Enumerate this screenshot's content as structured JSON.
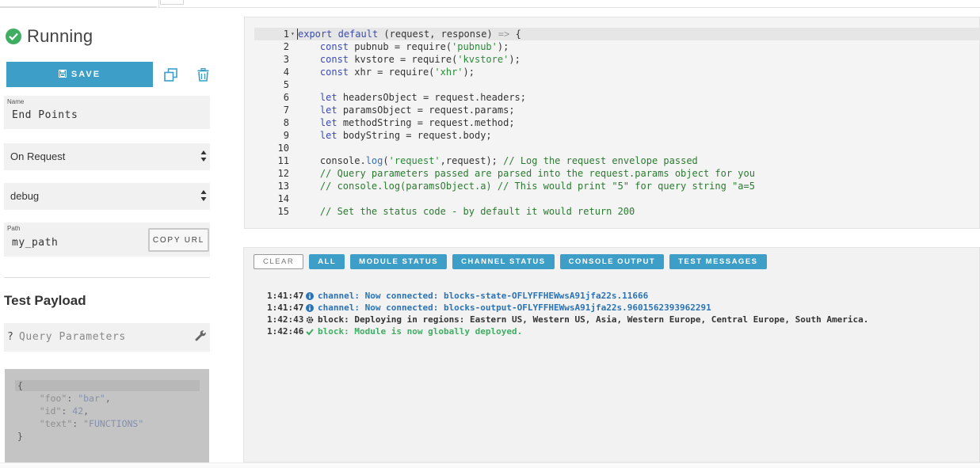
{
  "status": {
    "label": "Running",
    "icon": "check-circle-icon",
    "color": "#3fae63"
  },
  "toolbar": {
    "save_label": "SAVE"
  },
  "form": {
    "name_label": "Name",
    "name_value": "End Points",
    "event_value": "On Request",
    "log_value": "debug",
    "path_label": "Path",
    "path_value": "my_path",
    "copy_url_label": "COPY URL"
  },
  "test_payload": {
    "title": "Test Payload",
    "query_prefix": "?",
    "query_placeholder": "Query Parameters",
    "json_lines": [
      {
        "kind": "open",
        "text": "{"
      },
      {
        "kind": "pair",
        "key": "\"foo\"",
        "sep": ": ",
        "value": "\"bar\"",
        "end": ","
      },
      {
        "kind": "pair",
        "key": "\"id\"",
        "sep": ": ",
        "value": "42",
        "end": ","
      },
      {
        "kind": "pair",
        "key": "\"text\"",
        "sep": ": ",
        "value": "\"FUNCTIONS\"",
        "end": ""
      },
      {
        "kind": "close",
        "text": "}"
      }
    ]
  },
  "editor": {
    "lines": [
      "export default (request, response) => {",
      "    const pubnub = require('pubnub');",
      "    const kvstore = require('kvstore');",
      "    const xhr = require('xhr');",
      "",
      "    let headersObject = request.headers;",
      "    let paramsObject = request.params;",
      "    let methodString = request.method;",
      "    let bodyString = request.body;",
      "",
      "    console.log('request',request); // Log the request envelope passed",
      "    // Query parameters passed are parsed into the request.params object for you",
      "    // console.log(paramsObject.a) // This would print \"5\" for query string \"a=5",
      "",
      "    // Set the status code - by default it would return 200"
    ]
  },
  "console": {
    "tabs": [
      "CLEAR",
      "ALL",
      "MODULE STATUS",
      "CHANNEL STATUS",
      "CONSOLE OUTPUT",
      "TEST MESSAGES"
    ],
    "logs": [
      {
        "time": "1:41:47",
        "icon": "info-icon",
        "type": "info",
        "text": "channel: Now connected: blocks-state-OFLYFFHEWwsA91jfa22s.11666"
      },
      {
        "time": "1:41:47",
        "icon": "info-icon",
        "type": "info",
        "text": "channel: Now connected: blocks-output-OFLYFFHEWwsA91jfa22s.9601562393962291"
      },
      {
        "time": "1:42:43",
        "icon": "gear-icon",
        "type": "gear",
        "text": "block: Deploying in regions: Eastern US, Western US, Asia, Western Europe, Central Europe, South America."
      },
      {
        "time": "1:42:46",
        "icon": "check-icon",
        "type": "ok",
        "text": "block: Module is now globally deployed."
      }
    ]
  },
  "colors": {
    "accent": "#3d9fc7",
    "success": "#3fae63",
    "info": "#2a73b5"
  }
}
